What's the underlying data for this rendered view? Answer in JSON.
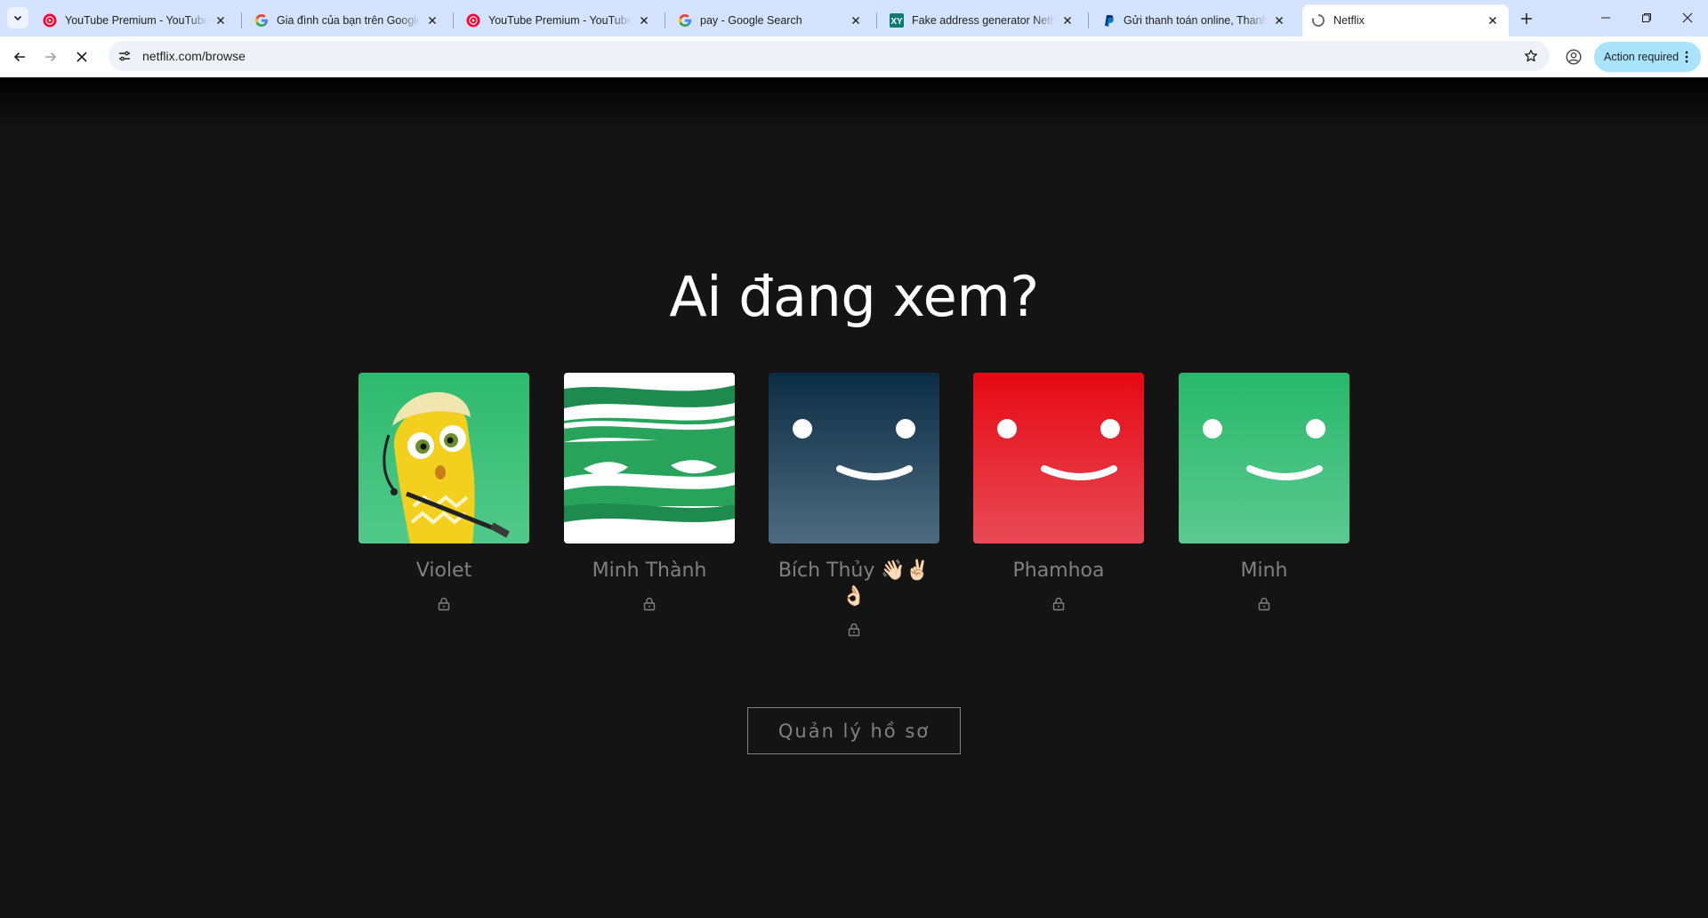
{
  "browser": {
    "tabs": [
      {
        "title": "YouTube Premium - YouTube Music",
        "favicon": "youtube-music-icon"
      },
      {
        "title": "Gia đình của bạn trên Google",
        "favicon": "google-icon"
      },
      {
        "title": "YouTube Premium - YouTube Music",
        "favicon": "youtube-music-icon"
      },
      {
        "title": "pay - Google Search",
        "favicon": "google-icon"
      },
      {
        "title": "Fake address generator Netherlands",
        "favicon": "xy-icon"
      },
      {
        "title": "Gửi thanh toán online, Thanh toán",
        "favicon": "paypal-icon"
      },
      {
        "title": "Netflix",
        "favicon": "loading-icon",
        "active": true
      }
    ],
    "url": "netflix.com/browse",
    "action_required": "Action required"
  },
  "netflix": {
    "heading": "Ai đang xem?",
    "profiles": [
      {
        "name": "Violet",
        "avatar": "yellow-character-avatar",
        "locked": true
      },
      {
        "name": "Minh Thành",
        "avatar": "green-mummy-avatar",
        "locked": true
      },
      {
        "name": "Bích Thủy 👋🏻✌🏻👌🏻",
        "avatar": "dark-blue-smiley-avatar",
        "locked": true
      },
      {
        "name": "Phamhoa",
        "avatar": "red-smiley-avatar",
        "locked": true
      },
      {
        "name": "Minh",
        "avatar": "green-smiley-avatar",
        "locked": true
      }
    ],
    "manage_button": "Quản lý hồ sơ"
  },
  "colors": {
    "tabstrip": "#d3e3fd",
    "page_background": "#141414",
    "profile_text": "#808080",
    "avatar_green": "#27b86a",
    "avatar_red": "#e50914",
    "avatar_dark_blue": "#0d3b55"
  }
}
